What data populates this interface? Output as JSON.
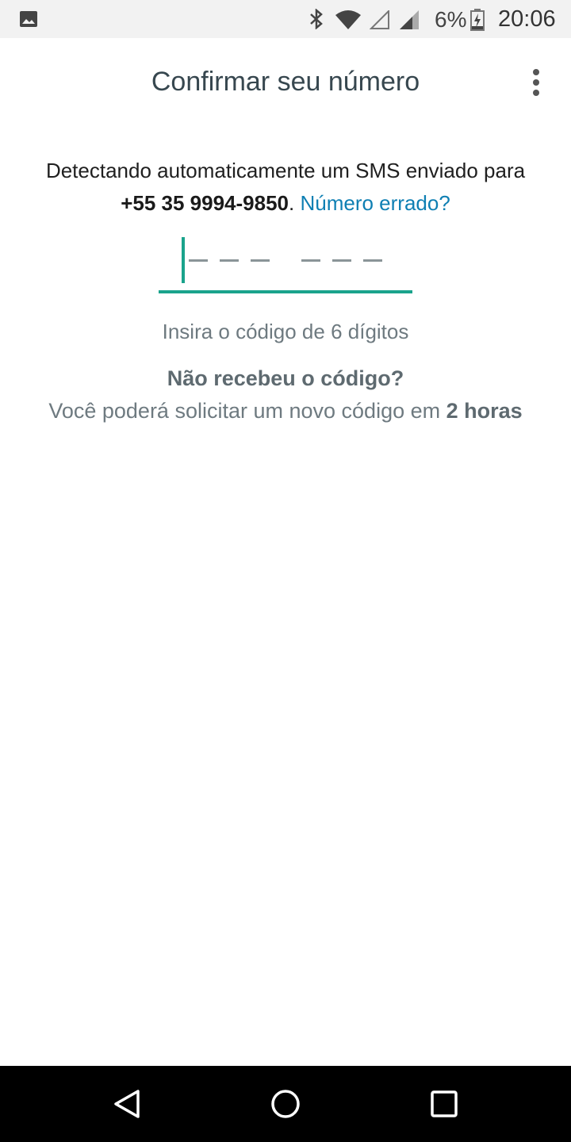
{
  "status_bar": {
    "battery_percent": "6%",
    "time": "20:06",
    "icons": [
      "gallery-icon",
      "bluetooth-icon",
      "wifi-icon",
      "signal-empty-icon",
      "signal-icon",
      "battery-charging-icon"
    ]
  },
  "header": {
    "title": "Confirmar seu número",
    "menu_icon": "more-vert-icon"
  },
  "main": {
    "description_prefix": "Detectando automaticamente um SMS enviado para",
    "phone_number": "+55 35 9994-9850",
    "period": ".",
    "wrong_number_link": "Número errado?",
    "code_value": "",
    "code_hint": "Insira o código de 6 dígitos",
    "resend_title": "Não recebeu o código?",
    "resend_prefix": "Você poderá solicitar um novo código em",
    "resend_wait": "2 horas"
  },
  "nav_bar": {
    "icons": [
      "back-icon",
      "home-icon",
      "recents-icon"
    ]
  },
  "colors": {
    "accent": "#1aa38c",
    "link": "#0e7fb3",
    "title": "#37474f"
  }
}
